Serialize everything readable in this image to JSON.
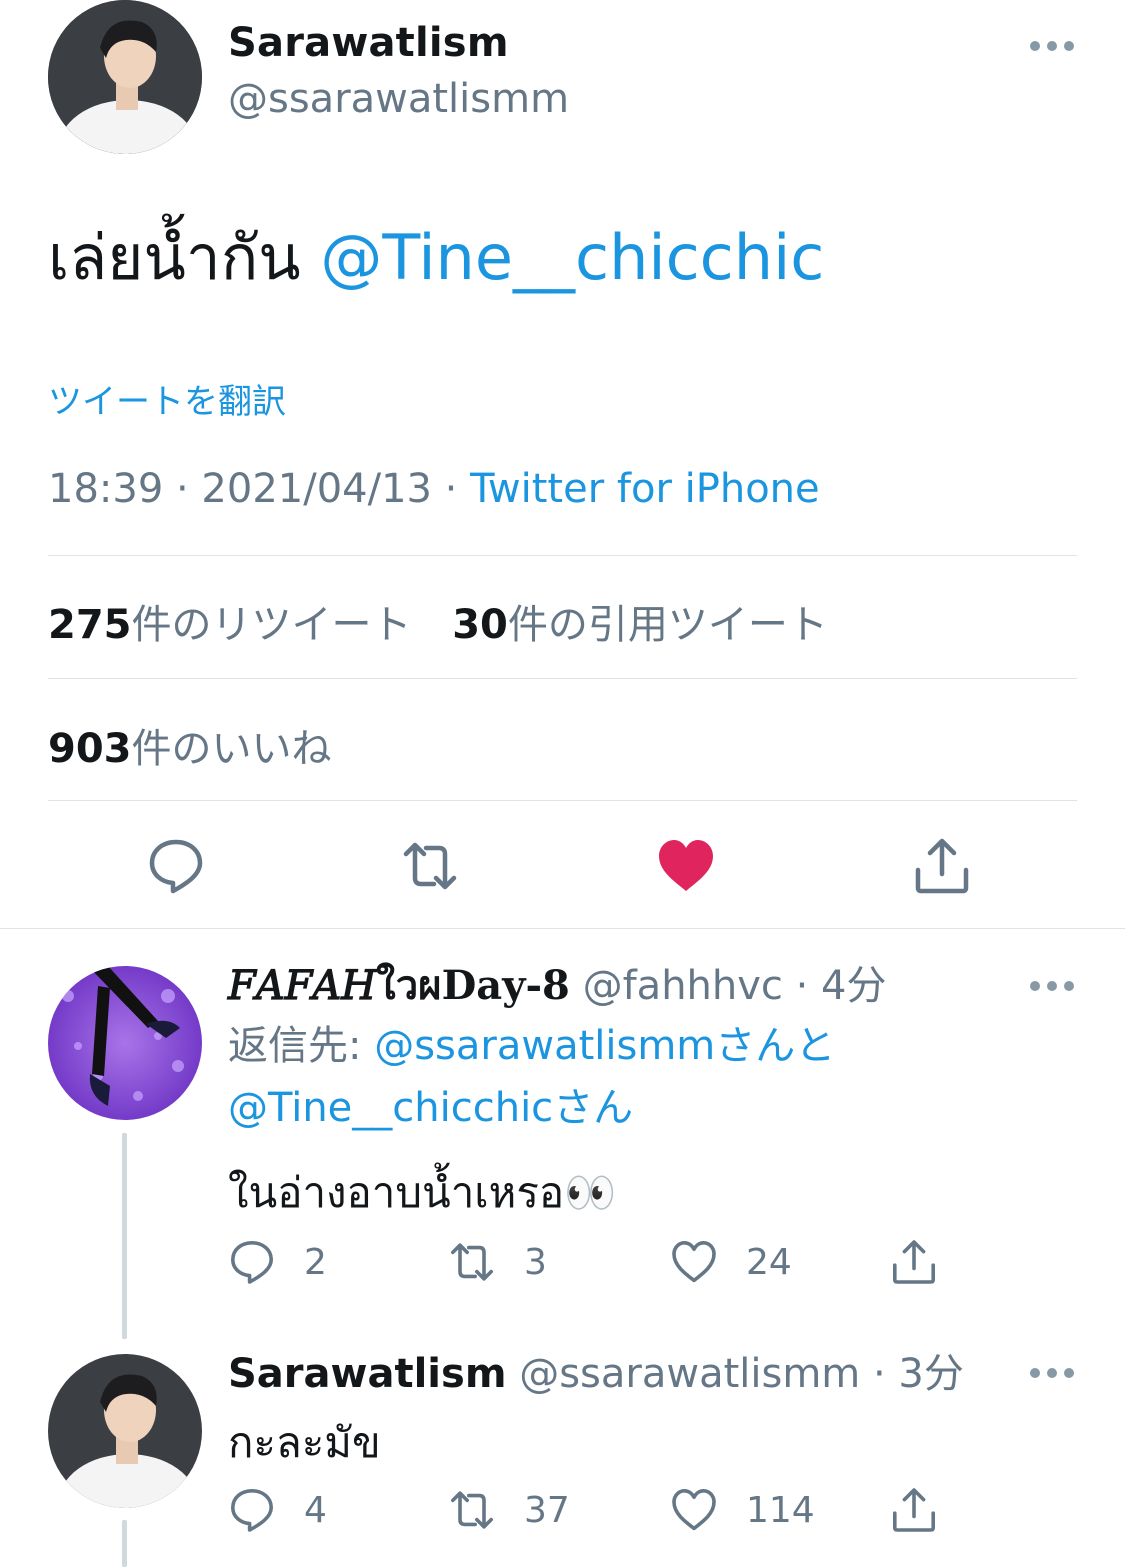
{
  "main": {
    "name": "Sarawatlism",
    "handle": "@ssarawatlismm",
    "text": "เล่ยน้ำกัน",
    "mention": "@Tine__chicchic",
    "translate": "ツイートを翻訳",
    "time": "18:39 · 2021/04/13 · ",
    "source": "Twitter for iPhone",
    "retweets_count": "275",
    "retweets_label": "件のリツイート",
    "quotes_count": "30",
    "quotes_label": "件の引用ツイート",
    "likes_count": "903",
    "likes_label": "件のいいね"
  },
  "replies": [
    {
      "display_name": "𝐹𝐴𝐹𝐴𝐻ใวผDay-8",
      "handle": "@fahhhvc",
      "time": "· 4分",
      "reply_to_prefix": "返信先: ",
      "reply_to_1": "@ssarawatlismm",
      "reply_to_mid": "さんと",
      "reply_to_2": "@Tine__chicchic",
      "reply_to_suffix": "さん",
      "text": "ในอ่างอาบน้ำเหรอ👀",
      "replies": "2",
      "retweets": "3",
      "likes": "24"
    },
    {
      "display_name": "Sarawatlism",
      "handle": "@ssarawatlismm",
      "time": "· 3分",
      "text": "กะละมัข",
      "replies": "4",
      "retweets": "37",
      "likes": "114"
    }
  ],
  "colors": {
    "link": "#1b95e0",
    "muted": "#657786",
    "like_active": "#e0245e"
  }
}
